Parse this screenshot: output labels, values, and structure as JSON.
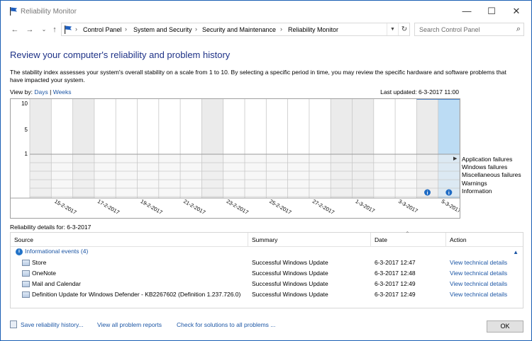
{
  "window": {
    "title": "Reliability Monitor",
    "minimize": "—",
    "maximize": "☐",
    "close": "✕"
  },
  "nav": {
    "back": "←",
    "forward": "→",
    "recent": "⌄",
    "up": "↑"
  },
  "address": {
    "crumbs": [
      "Control Panel",
      "System and Security",
      "Security and Maintenance",
      "Reliability Monitor"
    ],
    "separator": "›",
    "search_placeholder": "Search Control Panel"
  },
  "main": {
    "heading": "Review your computer's reliability and problem history",
    "description": "The stability index assesses your system's overall stability on a scale from 1 to 10. By selecting a specific period in time, you may review the specific hardware and software problems that have impacted your system.",
    "view_by_label": "View by:",
    "view_days": "Days",
    "view_divider": "|",
    "view_weeks": "Weeks",
    "last_updated": "Last updated: 6-3-2017 11:00"
  },
  "chart_data": {
    "type": "table",
    "y_ticks": [
      "10",
      "5",
      "1"
    ],
    "date_labels": [
      "15-2-2017",
      "17-2-2017",
      "19-2-2017",
      "21-2-2017",
      "23-2-2017",
      "25-2-2017",
      "27-2-2017",
      "1-3-2017",
      "3-3-2017",
      "5-3-2017"
    ],
    "columns": 20,
    "weekend_columns": [
      0,
      2,
      8,
      14,
      15,
      18
    ],
    "selected_column": 19,
    "stability_index": [
      null,
      null,
      null,
      null,
      null,
      null,
      null,
      null,
      null,
      null,
      null,
      null,
      null,
      null,
      null,
      null,
      null,
      null,
      10,
      10
    ],
    "information_markers": [
      18,
      19
    ],
    "rows": [
      "Application failures",
      "Windows failures",
      "Miscellaneous failures",
      "Warnings",
      "Information"
    ]
  },
  "details": {
    "title": "Reliability details for: 6-3-2017",
    "columns": {
      "source": "Source",
      "summary": "Summary",
      "date": "Date",
      "action": "Action"
    },
    "group_label": "Informational events (4)",
    "rows": [
      {
        "source": "Store",
        "summary": "Successful Windows Update",
        "date": "6-3-2017 12:47",
        "action": "View  technical details"
      },
      {
        "source": "OneNote",
        "summary": "Successful Windows Update",
        "date": "6-3-2017 12:48",
        "action": "View  technical details"
      },
      {
        "source": "Mail and Calendar",
        "summary": "Successful Windows Update",
        "date": "6-3-2017 12:49",
        "action": "View  technical details"
      },
      {
        "source": "Definition Update for Windows Defender - KB2267602 (Definition 1.237.726.0)",
        "summary": "Successful Windows Update",
        "date": "6-3-2017 12:49",
        "action": "View  technical details"
      }
    ]
  },
  "footer": {
    "save_history": "Save reliability history...",
    "view_all": "View all problem reports",
    "check_solutions": "Check for solutions to all problems ...",
    "ok": "OK"
  },
  "colors": {
    "accent": "#1c56a5",
    "heading": "#1e3287",
    "selected_column": "#bcdcf4",
    "weekend_column": "#ebebeb",
    "stability_line": "#2a6dc2"
  },
  "icons": {
    "flag": "flag-icon",
    "search": "search-icon",
    "info": "information-icon",
    "app": "app-icon"
  }
}
